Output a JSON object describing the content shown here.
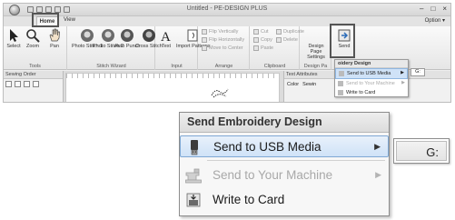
{
  "app": {
    "title": "Untitled - PE-DESIGN PLUS",
    "option_label": "Option",
    "window_controls": [
      "–",
      "□",
      "×"
    ],
    "tabs": [
      {
        "label": "Home",
        "active": true
      },
      {
        "label": "View",
        "active": false
      }
    ]
  },
  "ribbon": {
    "tools": {
      "label": "Tools",
      "buttons": [
        {
          "label": "Select",
          "icon": "cursor-icon"
        },
        {
          "label": "Zoom",
          "icon": "magnifier-icon"
        },
        {
          "label": "Pan",
          "icon": "hand-icon"
        }
      ]
    },
    "stitch_wizard": {
      "label": "Stitch Wizard",
      "buttons": [
        {
          "label": "Photo Stitch 1",
          "icon": "portrait-icon"
        },
        {
          "label": "Photo Stitch 2",
          "icon": "portrait-icon"
        },
        {
          "label": "Auto Punch",
          "icon": "portrait-icon"
        },
        {
          "label": "Cross Stitch",
          "icon": "portrait-icon"
        }
      ]
    },
    "input": {
      "label": "Input",
      "buttons": [
        {
          "label": "Text",
          "icon": "text-icon"
        },
        {
          "label": "Import Patterns",
          "icon": "import-icon"
        }
      ]
    },
    "arrange": {
      "label": "Arrange",
      "items": [
        "Flip Vertically",
        "Flip Horizontally",
        "Move to Center"
      ]
    },
    "clipboard": {
      "label": "Clipboard",
      "items": [
        "Cut",
        "Copy",
        "Paste",
        "Duplicate",
        "Delete"
      ]
    },
    "design_page": {
      "label": "Design Pa",
      "button": "Design Page Settings"
    },
    "send": {
      "label": "Send"
    }
  },
  "panels": {
    "sewing_order": "Sewing Order",
    "text_attributes": "Text Attributes",
    "color": "Color",
    "sewing": "Sewin"
  },
  "mini_menu": {
    "header": "Send Embroidery Design",
    "header_visible": "oidery Design",
    "items": [
      {
        "label": "Send to USB Media",
        "state": "selected"
      },
      {
        "label": "Send to Your Machine",
        "state": "disabled"
      },
      {
        "label": "Write to Card",
        "state": "normal"
      }
    ],
    "submenu": "G:"
  },
  "zoom_menu": {
    "header": "Send Embroidery Design",
    "items": [
      {
        "label": "Send to USB Media",
        "icon": "usb-drive-icon",
        "state": "selected",
        "has_submenu": true
      },
      {
        "label": "Send to Your Machine",
        "icon": "sewing-machine-icon",
        "state": "disabled",
        "has_submenu": true
      },
      {
        "label": "Write to Card",
        "icon": "card-write-icon",
        "state": "normal",
        "has_submenu": false
      }
    ],
    "submenu_drive": "G:",
    "submenu_arrow": "▶"
  },
  "colors": {
    "highlight_border": "#555555",
    "selected_bg": "#cfe2f7",
    "selected_border": "#7fa8d4",
    "disabled_text": "#a8a8a8"
  }
}
